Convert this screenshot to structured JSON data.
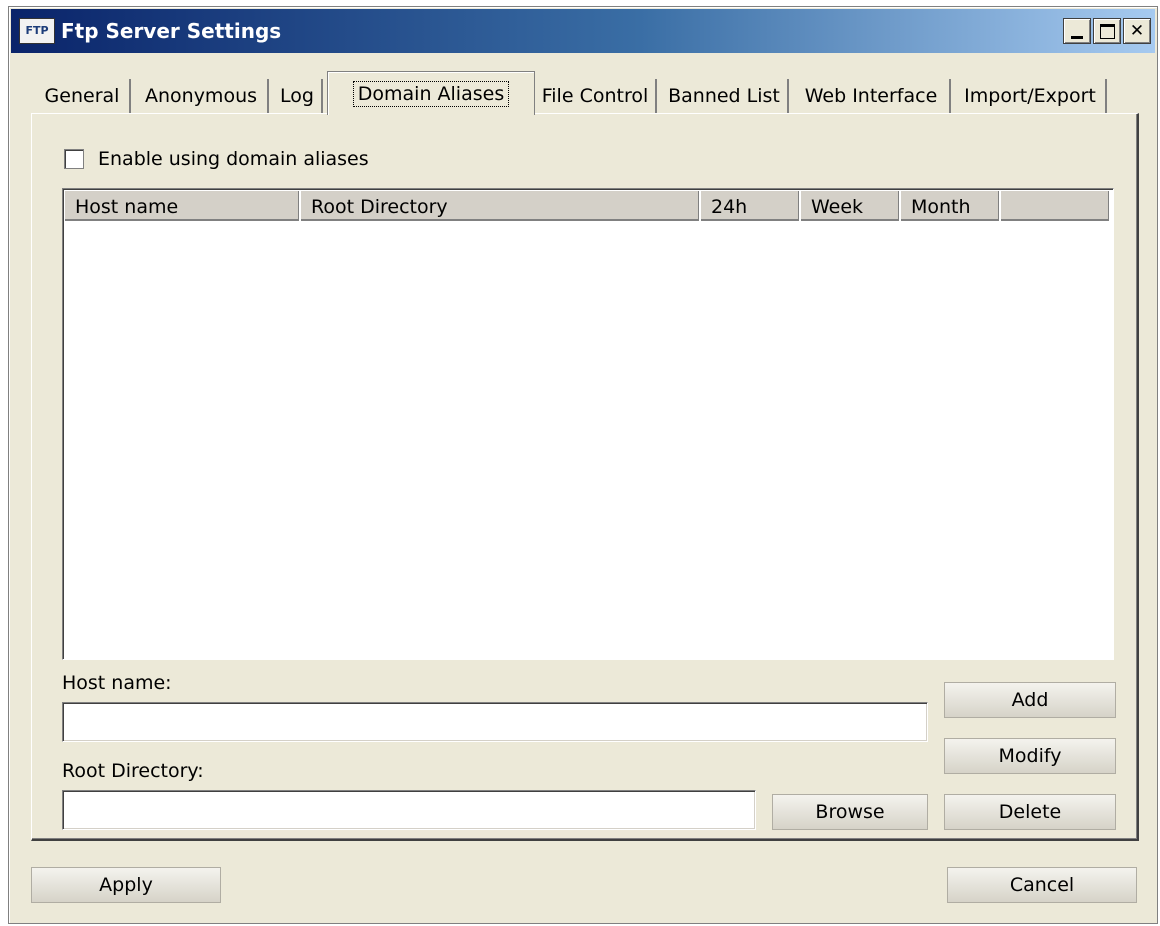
{
  "window": {
    "title": "Ftp Server Settings",
    "icon_text": "FTP",
    "controls": {
      "minimize": "minimize-icon",
      "maximize": "maximize-icon",
      "close": "close-icon",
      "close_glyph": "✕"
    }
  },
  "tabs": [
    {
      "label": "General",
      "active": false
    },
    {
      "label": "Anonymous",
      "active": false
    },
    {
      "label": "Log",
      "active": false
    },
    {
      "label": "Domain Aliases",
      "active": true
    },
    {
      "label": "File Control",
      "active": false
    },
    {
      "label": "Banned List",
      "active": false
    },
    {
      "label": "Web Interface",
      "active": false
    },
    {
      "label": "Import/Export",
      "active": false
    }
  ],
  "domain_aliases": {
    "enable_checkbox": {
      "label": "Enable using domain aliases",
      "checked": false
    },
    "columns": [
      "Host name",
      "Root Directory",
      "24h",
      "Week",
      "Month"
    ],
    "rows": [],
    "host_name_label": "Host name:",
    "host_name_value": "",
    "root_directory_label": "Root Directory:",
    "root_directory_value": "",
    "browse_label": "Browse",
    "add_label": "Add",
    "modify_label": "Modify",
    "delete_label": "Delete"
  },
  "footer": {
    "apply_label": "Apply",
    "cancel_label": "Cancel"
  }
}
